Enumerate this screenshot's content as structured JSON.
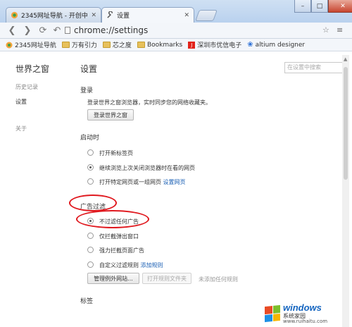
{
  "tabs": [
    {
      "label": "2345网址导航 - 开创中国",
      "active": false
    },
    {
      "label": "设置",
      "active": true
    }
  ],
  "window_controls": {
    "minimize": "–",
    "maximize": "□",
    "close": "✕"
  },
  "address_bar": {
    "url": "chrome://settings"
  },
  "bookmarks": [
    {
      "label": "2345网址导航",
      "icon": "2345-icon"
    },
    {
      "label": "万有引力",
      "icon": "folder-icon"
    },
    {
      "label": "芯之度",
      "icon": "folder-icon"
    },
    {
      "label": "Bookmarks",
      "icon": "folder-icon"
    },
    {
      "label": "深圳市优信电子",
      "icon": "jd-icon"
    },
    {
      "label": "altium designer",
      "icon": "paw-icon"
    }
  ],
  "sidebar": {
    "title": "世界之窗",
    "items": [
      {
        "label": "历史记录"
      },
      {
        "label": "设置"
      },
      {
        "label": "关于"
      }
    ]
  },
  "main": {
    "title": "设置",
    "search_placeholder": "在设置中搜索",
    "login": {
      "heading": "登录",
      "description": "登录世界之窗浏览器，实时同步您的网络收藏夹。",
      "button": "登录世界之窗"
    },
    "startup": {
      "heading": "启动时",
      "options": [
        {
          "label": "打开新标签页",
          "checked": false
        },
        {
          "label": "继续浏览上次关闭浏览器时在看的网页",
          "checked": true
        },
        {
          "label": "打开特定网页或一组网页",
          "link": "设置网页",
          "checked": false
        }
      ]
    },
    "adblock": {
      "heading": "广告过滤",
      "options": [
        {
          "label": "不过滤任何广告",
          "checked": true
        },
        {
          "label": "仅拦截弹出窗口",
          "checked": false
        },
        {
          "label": "强力拦截页面广告",
          "checked": false
        },
        {
          "label": "自定义过滤规则",
          "link": "添加规则",
          "checked": false
        }
      ],
      "manage_button": "管理例外网站...",
      "open_rules_button": "打开规则文件夹",
      "status": "未添加任何规则"
    },
    "tabs_section": {
      "heading": "标签"
    }
  },
  "watermark": {
    "main": "windows",
    "sub": "系统家园",
    "domain": "www.ruihaitu.com"
  }
}
